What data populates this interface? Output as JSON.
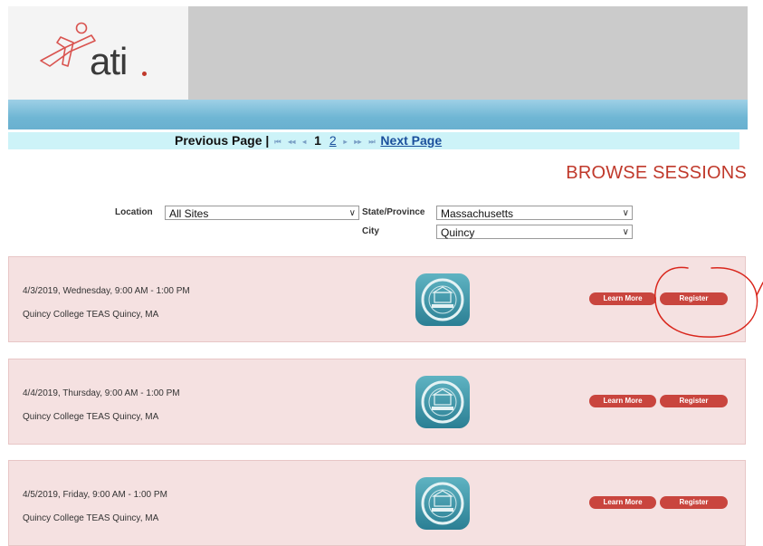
{
  "header": {
    "logo_text": "ati"
  },
  "pager": {
    "previous_label": "Previous Page",
    "separator": "|",
    "first_glyph": "⏮",
    "prev_fast_glyph": "◂◂",
    "prev_glyph": "◂",
    "current_page": "1",
    "page_2": "2",
    "next_glyph": "▸",
    "next_fast_glyph": "▸▸",
    "last_glyph": "⏭",
    "next_label": "Next Page"
  },
  "title": "BROWSE SESSIONS",
  "filters": {
    "location_label": "Location",
    "location_value": "All Sites",
    "state_label": "State/Province",
    "state_value": "Massachusetts",
    "city_label": "City",
    "city_value": "Quincy"
  },
  "sessions": [
    {
      "date": "4/3/2019, Wednesday, 9:00 AM - 1:00 PM",
      "location": "Quincy College TEAS Quincy, MA",
      "learn_label": "Learn More",
      "register_label": "Register"
    },
    {
      "date": "4/4/2019, Thursday, 9:00 AM - 1:00 PM",
      "location": "Quincy College TEAS Quincy, MA",
      "learn_label": "Learn More",
      "register_label": "Register"
    },
    {
      "date": "4/5/2019, Friday, 9:00 AM - 1:00 PM",
      "location": "Quincy College TEAS Quincy, MA",
      "learn_label": "Learn More",
      "register_label": "Register"
    }
  ],
  "icons": {
    "logo": "ati-figure-logo-icon",
    "chevron": "chevron-down-icon",
    "seal": "quincy-college-seal-icon"
  },
  "colors": {
    "accent_red": "#c0392b",
    "button_red": "#c9453e",
    "card_bg": "#f5e1e1",
    "pager_bg": "#cdf3f8",
    "band_blue": "#6fb6d4",
    "link_blue": "#1a4f9c",
    "annotation_red": "#d9261c"
  }
}
